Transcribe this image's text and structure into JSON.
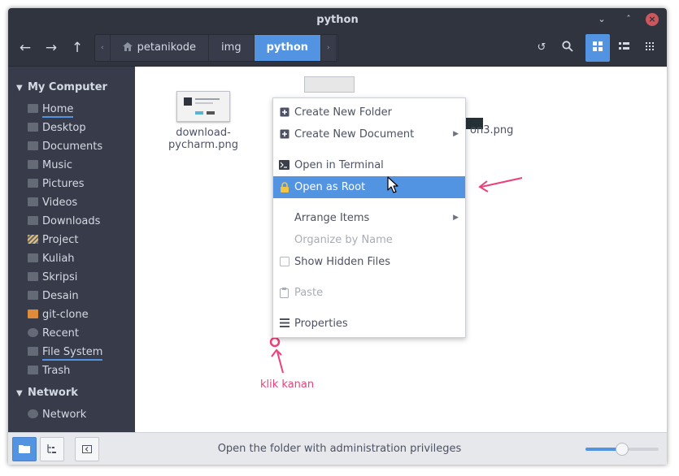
{
  "window": {
    "title": "python"
  },
  "breadcrumb": [
    "petanikode",
    "img",
    "python"
  ],
  "sidebar": {
    "sections": [
      {
        "label": "My Computer",
        "items": [
          "Home",
          "Desktop",
          "Documents",
          "Music",
          "Pictures",
          "Videos",
          "Downloads",
          "Project",
          "Kuliah",
          "Skripsi",
          "Desain",
          "git-clone",
          "Recent",
          "File System",
          "Trash"
        ]
      },
      {
        "label": "Network",
        "items": [
          "Network"
        ]
      }
    ],
    "selected": [
      "Home",
      "File System"
    ]
  },
  "files": [
    "download-pycharm.png",
    "on3.png"
  ],
  "context_menu": {
    "items": [
      "Create New Folder",
      "Create New Document",
      "Open in Terminal",
      "Open as Root",
      "Arrange Items",
      "Organize by Name",
      "Show Hidden Files",
      "Paste",
      "Properties"
    ],
    "highlighted": "Open as Root",
    "disabled": [
      "Organize by Name",
      "Paste"
    ]
  },
  "annotation": {
    "text": "klik kanan",
    "color": "#ec407a"
  },
  "statusbar": {
    "text": "Open the folder with administration privileges",
    "zoom_level": 0.5
  },
  "colors": {
    "accent": "#5294e2",
    "sidebar_bg": "#383c4a",
    "titlebar_bg": "#2f343f"
  }
}
